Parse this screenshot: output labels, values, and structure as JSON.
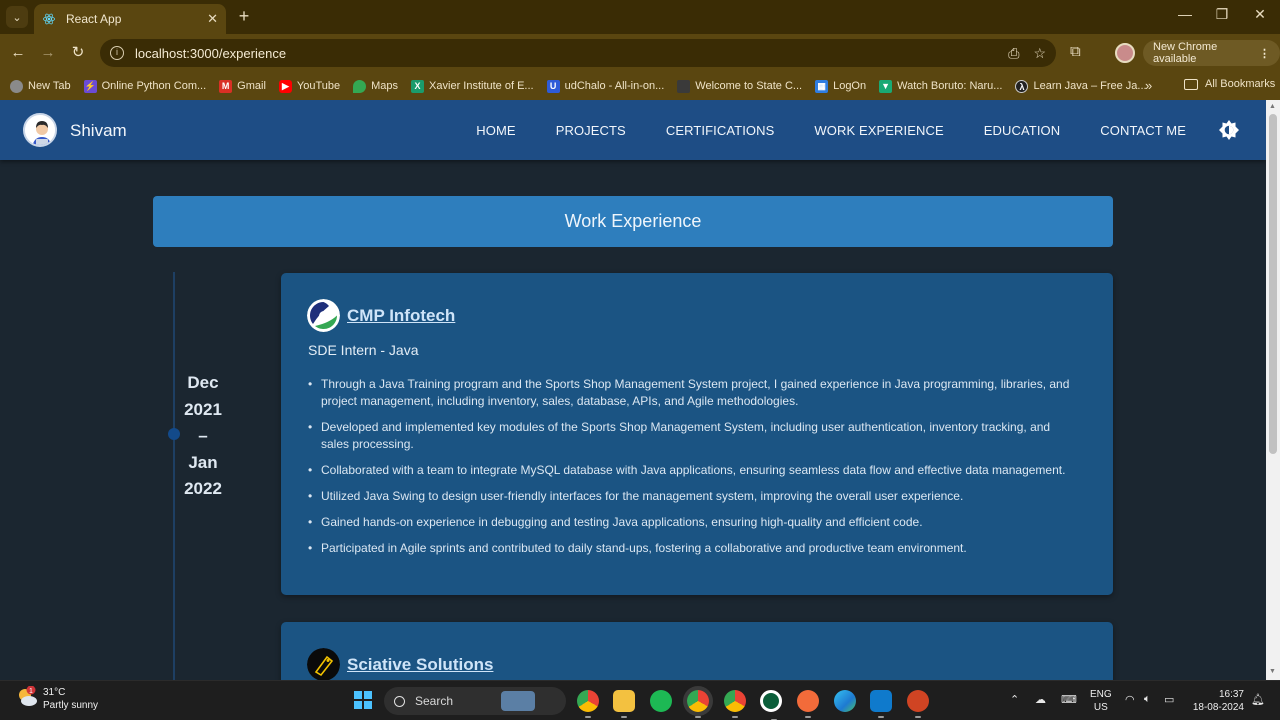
{
  "browser": {
    "tab_title": "React App",
    "url": "localhost:3000/experience",
    "update_label": "New Chrome available",
    "bookmarks": [
      {
        "label": "New Tab",
        "color": "#8a8a8a"
      },
      {
        "label": "Online Python Com...",
        "color": "#6b4bd6"
      },
      {
        "label": "Gmail",
        "color": "#d93025"
      },
      {
        "label": "YouTube",
        "color": "#ff0000"
      },
      {
        "label": "Maps",
        "color": "#34a853"
      },
      {
        "label": "Xavier Institute of E...",
        "color": "#1a9b6c"
      },
      {
        "label": "udChalo - All-in-on...",
        "color": "#2e5bd8"
      },
      {
        "label": "Welcome to State C...",
        "color": "#3a3a3a"
      },
      {
        "label": "LogOn",
        "color": "#2f7de1"
      },
      {
        "label": "Watch Boruto: Naru...",
        "color": "#19a974"
      },
      {
        "label": "Learn Java – Free Ja...",
        "color": "#222222"
      }
    ],
    "all_bookmarks": "All Bookmarks"
  },
  "app": {
    "brand": "Shivam",
    "nav": [
      "HOME",
      "PROJECTS",
      "CERTIFICATIONS",
      "WORK EXPERIENCE",
      "EDUCATION",
      "CONTACT ME"
    ],
    "section_title": "Work Experience",
    "experiences": [
      {
        "date_lines": [
          "Dec",
          "2021",
          "–",
          "Jan",
          "2022"
        ],
        "company": "CMP Infotech",
        "role": "SDE Intern - Java",
        "bullets": [
          "Through a Java Training program and the Sports Shop Management System project, I gained experience in Java programming, libraries, and project management, including inventory, sales, database, APIs, and Agile methodologies.",
          "Developed and implemented key modules of the Sports Shop Management System, including user authentication, inventory tracking, and sales processing.",
          "Collaborated with a team to integrate MySQL database with Java applications, ensuring seamless data flow and effective data management.",
          "Utilized Java Swing to design user-friendly interfaces for the management system, improving the overall user experience.",
          "Gained hands-on experience in debugging and testing Java applications, ensuring high-quality and efficient code.",
          "Participated in Agile sprints and contributed to daily stand-ups, fostering a collaborative and productive team environment."
        ]
      },
      {
        "company": "Sciative Solutions"
      }
    ]
  },
  "taskbar": {
    "weather_badge": "1",
    "temp": "31°C",
    "condition": "Partly sunny",
    "search_label": "Search",
    "lang": "ENG",
    "region": "US",
    "time": "16:37",
    "date": "18-08-2024"
  }
}
